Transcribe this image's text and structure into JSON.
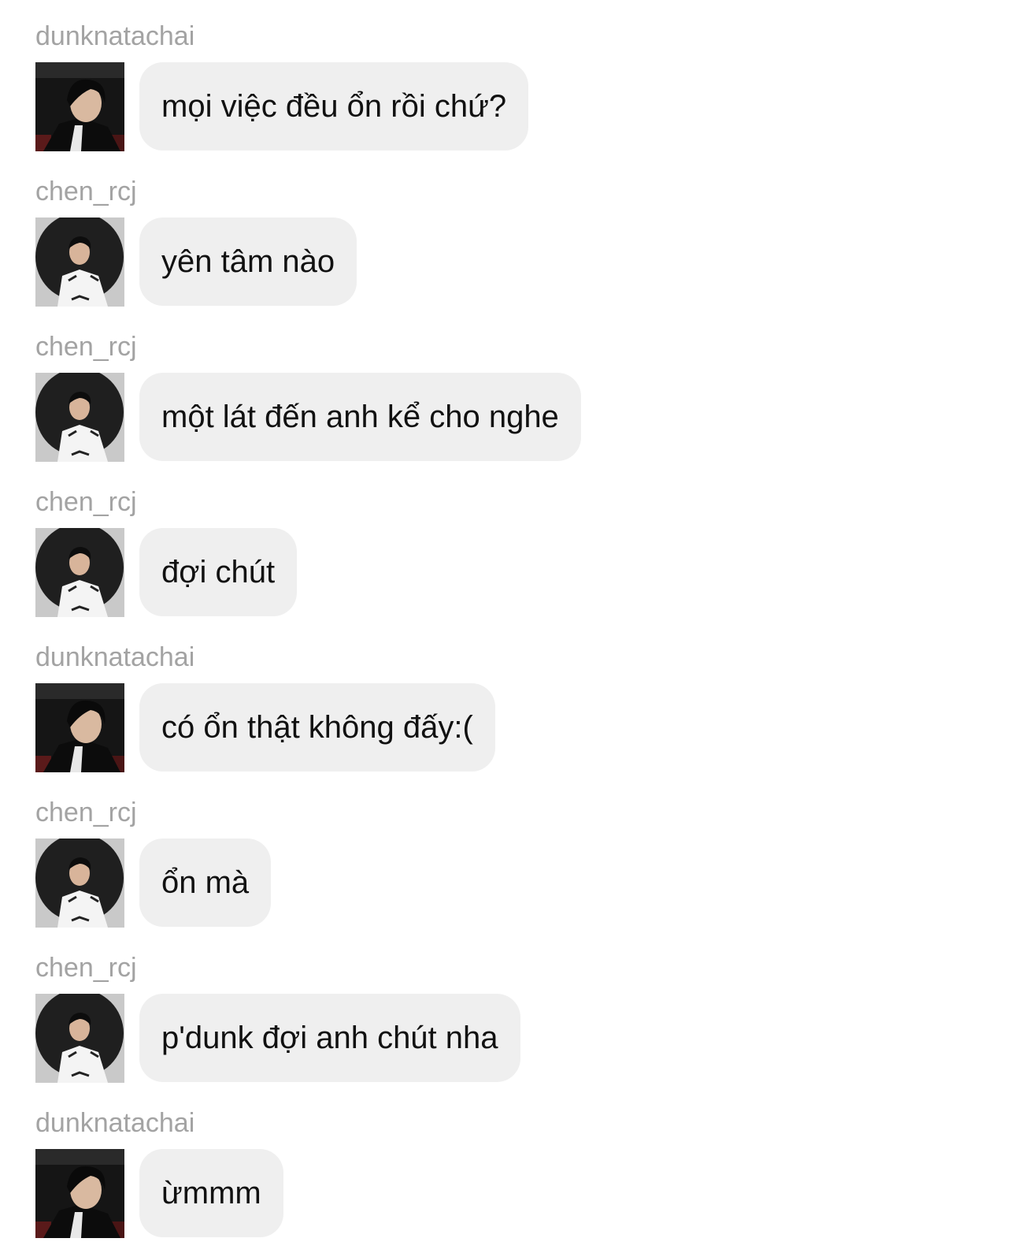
{
  "conversation": {
    "messages": [
      {
        "sender": "dunknatachai",
        "avatar": "avatar-dunk",
        "text": "mọi việc đều ổn rồi chứ?"
      },
      {
        "sender": "chen_rcj",
        "avatar": "avatar-chen",
        "text": "yên tâm nào"
      },
      {
        "sender": "chen_rcj",
        "avatar": "avatar-chen",
        "text": "một lát đến anh kể cho nghe"
      },
      {
        "sender": "chen_rcj",
        "avatar": "avatar-chen",
        "text": "đợi chút"
      },
      {
        "sender": "dunknatachai",
        "avatar": "avatar-dunk",
        "text": "có ổn thật không đấy:("
      },
      {
        "sender": "chen_rcj",
        "avatar": "avatar-chen",
        "text": "ổn mà"
      },
      {
        "sender": "chen_rcj",
        "avatar": "avatar-chen",
        "text": "p'dunk đợi anh chút nha"
      },
      {
        "sender": "dunknatachai",
        "avatar": "avatar-dunk",
        "text": "ừmmm"
      }
    ]
  },
  "colors": {
    "background": "#ffffff",
    "bubble": "#efefef",
    "username": "#a3a3a3",
    "text": "#111111"
  }
}
